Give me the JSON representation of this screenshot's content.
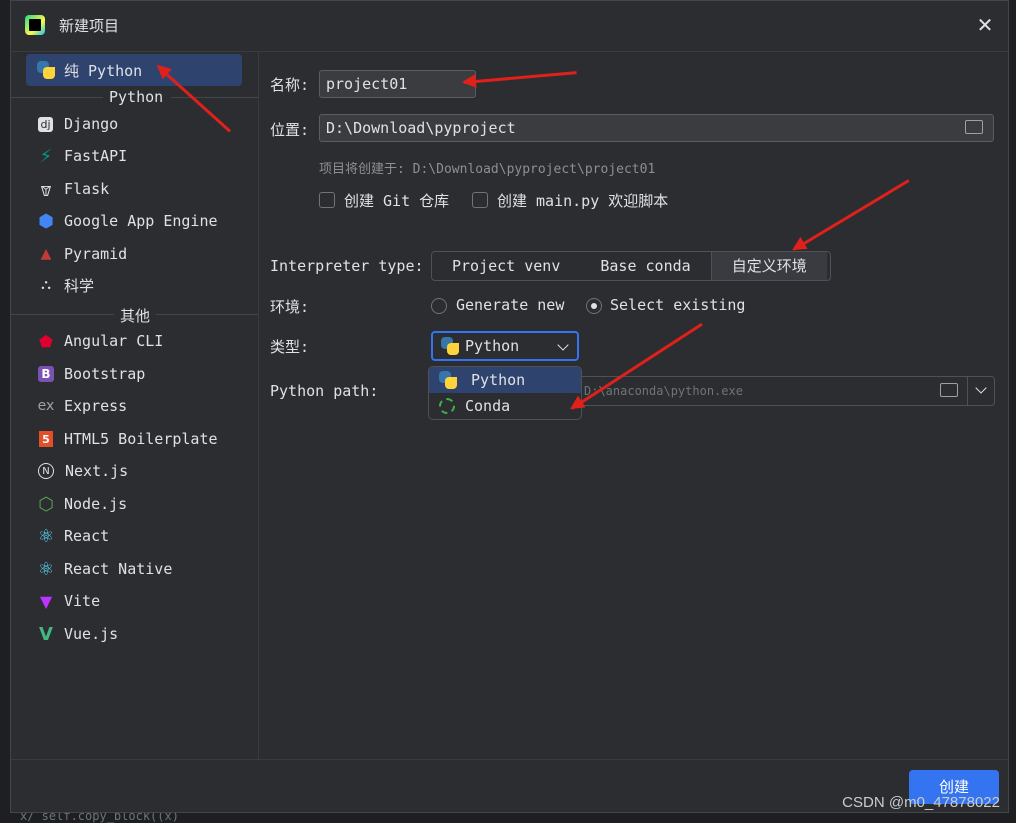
{
  "window": {
    "title": "新建项目",
    "close_glyph": "✕"
  },
  "sidebar": {
    "items": [
      {
        "label": "纯 Python",
        "icon": "python-icon",
        "selected": true
      },
      {
        "label": "Django",
        "icon": "django-icon"
      },
      {
        "label": "FastAPI",
        "icon": "fastapi-icon"
      },
      {
        "label": "Flask",
        "icon": "flask-icon"
      },
      {
        "label": "Google App Engine",
        "icon": "google-app-engine-icon"
      },
      {
        "label": "Pyramid",
        "icon": "pyramid-icon"
      },
      {
        "label": "科学",
        "icon": "scientific-icon"
      },
      {
        "label": "Angular CLI",
        "icon": "angular-icon"
      },
      {
        "label": "Bootstrap",
        "icon": "bootstrap-icon"
      },
      {
        "label": "Express",
        "icon": "express-icon"
      },
      {
        "label": "HTML5 Boilerplate",
        "icon": "html5-icon"
      },
      {
        "label": "Next.js",
        "icon": "nextjs-icon"
      },
      {
        "label": "Node.js",
        "icon": "nodejs-icon"
      },
      {
        "label": "React",
        "icon": "react-icon"
      },
      {
        "label": "React Native",
        "icon": "react-native-icon"
      },
      {
        "label": "Vite",
        "icon": "vite-icon"
      },
      {
        "label": "Vue.js",
        "icon": "vue-icon"
      }
    ],
    "section_python": "Python",
    "section_other": "其他"
  },
  "form": {
    "name_label": "名称:",
    "name_value": "project01",
    "location_label": "位置:",
    "location_value": "D:\\Download\\pyproject",
    "hint": "项目将创建于: D:\\Download\\pyproject\\project01",
    "git_checkbox": "创建 Git 仓库",
    "main_checkbox": "创建 main.py 欢迎脚本",
    "interpreter_type_label": "Interpreter type:",
    "interpreter_tabs": [
      "Project venv",
      "Base conda",
      "自定义环境"
    ],
    "interpreter_active": "自定义环境",
    "env_label": "环境:",
    "env_options": [
      "Generate new",
      "Select existing"
    ],
    "env_selected": "Select existing",
    "type_label": "类型:",
    "type_value": "Python",
    "type_options": [
      "Python",
      "Conda"
    ],
    "python_path_label": "Python path:",
    "python_path_value": "D:\\anaconda\\python.exe"
  },
  "footer": {
    "create_label": "创建"
  },
  "watermark": "CSDN @m0_47878022",
  "background_code": "x/    self.copy_block((x)",
  "colors": {
    "accent": "#3574f0",
    "selected": "#2e436e",
    "annotation_arrow": "#e0201b",
    "bg": "#2b2d30"
  }
}
